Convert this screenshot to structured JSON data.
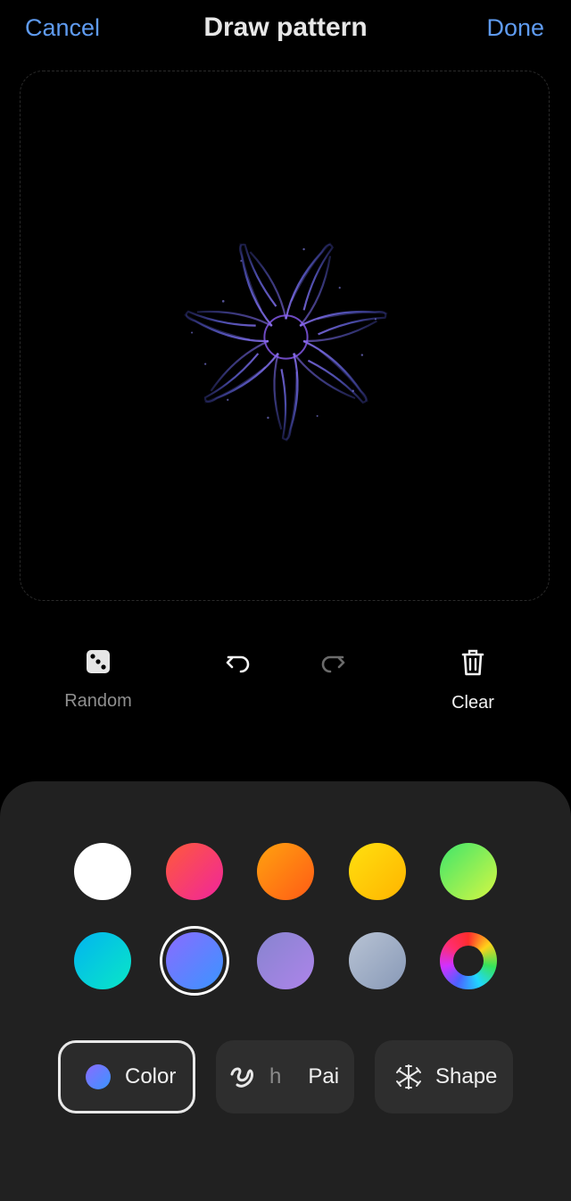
{
  "header": {
    "cancel_label": "Cancel",
    "title": "Draw pattern",
    "done_label": "Done"
  },
  "toolbar": {
    "random_label": "Random",
    "clear_label": "Clear"
  },
  "palette": {
    "selected_index": 6,
    "colors": [
      {
        "name": "white",
        "fill": "#ffffff"
      },
      {
        "name": "pink-red",
        "fill": "linear-gradient(135deg,#ff5a3a,#f0259c)"
      },
      {
        "name": "orange",
        "fill": "linear-gradient(135deg,#ffa20f,#ff5b16)"
      },
      {
        "name": "yellow",
        "fill": "linear-gradient(135deg,#ffe00f,#ffb400)"
      },
      {
        "name": "green",
        "fill": "linear-gradient(135deg,#3fe56b,#d6f743)"
      },
      {
        "name": "cyan",
        "fill": "linear-gradient(135deg,#02b4f0,#09e7c6)"
      },
      {
        "name": "blue-violet",
        "fill": "linear-gradient(135deg,#8a6bff,#3a95ff)"
      },
      {
        "name": "lavender",
        "fill": "linear-gradient(135deg,#8784cf,#ad84ea)"
      },
      {
        "name": "gray-blue",
        "fill": "linear-gradient(135deg,#b8c3d4,#8899b7)"
      },
      {
        "name": "color-wheel",
        "fill": "conic-gradient(#ff2d2d,#ffd21a,#36e35a,#20d7ff,#4a63ff,#d130ff,#ff2d6e,#ff2d2d)"
      }
    ]
  },
  "tabs": {
    "color_label": "Color",
    "brush_label_partial_1": "h",
    "brush_label_partial_2": "Pai",
    "shape_label": "Shape"
  }
}
